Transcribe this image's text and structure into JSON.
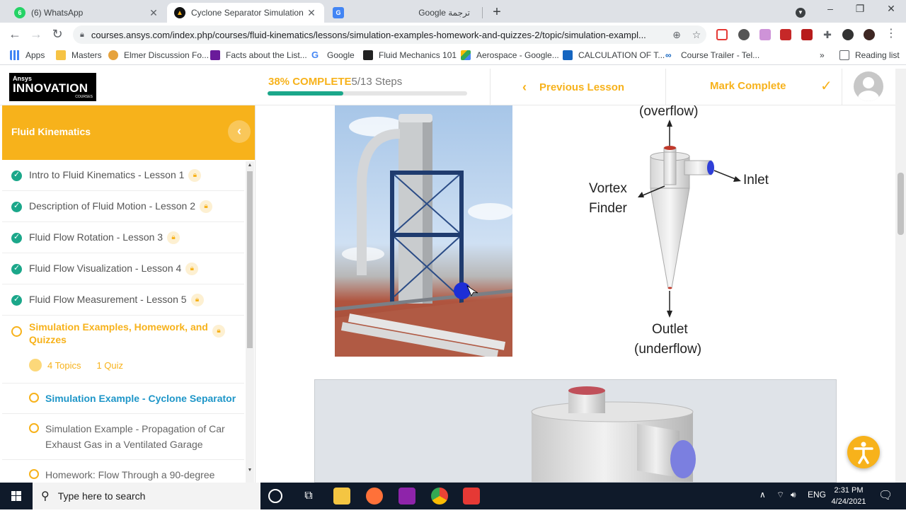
{
  "browser": {
    "tabs": [
      {
        "title": "(6) WhatsApp",
        "active": false
      },
      {
        "title": "Cyclone Separator Simulation Ex",
        "active": true
      },
      {
        "title": "Google ترجمة",
        "active": false
      }
    ],
    "url": "courses.ansys.com/index.php/courses/fluid-kinematics/lessons/simulation-examples-homework-and-quizzes-2/topic/simulation-exampl...",
    "bookmarks": [
      "Apps",
      "Masters",
      "Elmer Discussion Fo...",
      "Facts about the List...",
      "Google",
      "Fluid Mechanics 101",
      "Aerospace - Google...",
      "CALCULATION OF T...",
      "Course Trailer - Tel..."
    ],
    "reading_list": "Reading list"
  },
  "header": {
    "logo_top": "Ansys",
    "logo_main": "INNOVATION",
    "logo_sub": "COURSES",
    "progress_pct": "38% COMPLETE",
    "progress_steps": "5/13 Steps",
    "progress_fraction": 0.38,
    "previous_lesson": "Previous Lesson",
    "mark_complete": "Mark Complete"
  },
  "sidebar": {
    "course_title": "Fluid Kinematics",
    "lessons": [
      {
        "label": "Intro to Fluid Kinematics - Lesson 1",
        "status": "complete"
      },
      {
        "label": "Description of Fluid Motion - Lesson 2",
        "status": "complete"
      },
      {
        "label": "Fluid Flow Rotation - Lesson 3",
        "status": "complete"
      },
      {
        "label": "Fluid Flow Visualization - Lesson 4",
        "status": "complete"
      },
      {
        "label": "Fluid Flow Measurement - Lesson 5",
        "status": "complete"
      }
    ],
    "current_lesson": {
      "label": "Simulation Examples, Homework, and Quizzes",
      "topics_count": "4 Topics",
      "quiz_count": "1 Quiz"
    },
    "topics": [
      {
        "label": "Simulation Example - Cyclone Separator",
        "active": true
      },
      {
        "label": "Simulation Example - Propagation of Car Exhaust Gas in a Ventilated Garage",
        "active": false
      },
      {
        "label": "Homework: Flow Through a 90-degree",
        "active": false
      }
    ]
  },
  "diagram": {
    "overflow": "(overflow)",
    "inlet": "Inlet",
    "vortex": "Vortex",
    "finder": "Finder",
    "outlet": "Outlet",
    "underflow": "(underflow)"
  },
  "taskbar": {
    "search_placeholder": "Type here to search",
    "lang": "ENG",
    "time": "2:31 PM",
    "date": "4/24/2021"
  },
  "colors": {
    "accent": "#f7b21b",
    "success": "#1ba78a",
    "link": "#1e96c8"
  }
}
